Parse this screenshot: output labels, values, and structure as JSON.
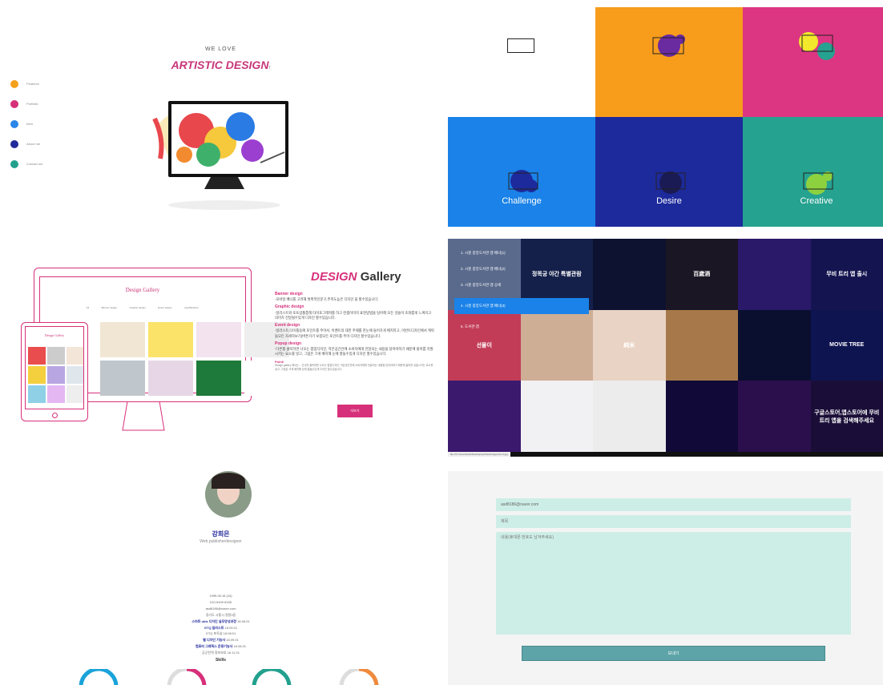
{
  "panel1": {
    "nav": [
      {
        "label": "Features",
        "color": "#f5a11c"
      },
      {
        "label": "Portfolio",
        "color": "#d7307a"
      },
      {
        "label": "Intro",
        "color": "#2a86e8"
      },
      {
        "label": "About me",
        "color": "#22299a"
      },
      {
        "label": "Contact me",
        "color": "#22a08e"
      }
    ],
    "we_love": "WE LOVE",
    "artistic": "ARTISTIC DESIGN",
    "artistic_suffix": "!"
  },
  "panel2": {
    "tiles": [
      {
        "label": "",
        "color": "#ffffff"
      },
      {
        "label": "",
        "color": "#f89c1c"
      },
      {
        "label": "",
        "color": "#dc3682"
      },
      {
        "label": "Challenge",
        "color": "#1a82e8"
      },
      {
        "label": "Desire",
        "color": "#1d2a9c"
      },
      {
        "label": "Creative",
        "color": "#26a290"
      }
    ]
  },
  "panel3": {
    "mock_title": "Design Gallery",
    "mock_tabs": [
      "All",
      "Banner design",
      "Graphic design",
      "Event design",
      "App/Web/etc."
    ],
    "tablet_title": "Design Gallery",
    "title_pink": "DESIGN",
    "title_dark": "Gallery",
    "sections": [
      {
        "h": "Banner design",
        "t": "-모바일 배너를 고려해 쌍촉적인문구,주목도높은 디자인 을 할수있습니다."
      },
      {
        "h": "Graphic design",
        "t": "-일러스트와 포토샵툴통해 타이포그래피를 하고 컨셉이미지 표현방법을 담아해 모든 것들이 조화롭게 느껴지고 의미가 전달될수있게 디자인 할수있습니다."
      },
      {
        "h": "Event design",
        "t": "-일러스트,타이틀등에 포인트를 주어서, 이벤트의 대한 주제를 한눈에 들어가게 배치하고, 이번트디자인에서 캐릭들모든 자세하보기(버튼가기 보봉모든 포인트를 주어 디자인 할수있습니다."
      },
      {
        "h": "Popup design",
        "t": "-다른를 클릭하면 나오는 팝업디자인, 작은공간안에 소비자에게 전달되는 내용을 담아야하기 때문에 홍미롭 유발시키는 요소를 넣고, 그림은 크게 배치해 눈에 잘들수있게 디자인 할수있습니다."
      },
      {
        "h": "Point!",
        "t": "Design gallery 에서는... 선사를 클릭하면 나오는 팝업디자인, 작은공간안에 소비자에게 전달되는 내용을 담아야하기 때문에 흥미를 유발시키는 요소를 넣고, 그림은 크게 배치해 눈에 잘들수있게 디자인 할수있습니다."
      }
    ],
    "button": "더보기"
  },
  "panel4": {
    "menu": [
      "1. 시흥 중앙도서관 앱 배너(1)",
      "2. 시흥 중앙도서관 앱 배너(2)",
      "3. 시흥 중앙도서관 앱 상세",
      "4. 시흥 중앙도서관 앱 배너(3)",
      "5. 도서관 앱"
    ],
    "active_index": 3,
    "thumbs": [
      {
        "text": "",
        "color": "#5a6a8c"
      },
      {
        "text": "정목궁 야간 특별관람",
        "color": "#14204a"
      },
      {
        "text": "",
        "color": "#0d1230"
      },
      {
        "text": "百歲酒",
        "color": "#1a1624"
      },
      {
        "text": "",
        "color": "#2a1868"
      },
      {
        "text": "무비 트리 앱 출시",
        "color": "#141450"
      },
      {
        "text": "선물이",
        "color": "#c23c58"
      },
      {
        "text": "",
        "color": "#cfae96"
      },
      {
        "text": "純米",
        "color": "#e9d3c4"
      },
      {
        "text": "",
        "color": "#a7794a"
      },
      {
        "text": "",
        "color": "#0a0f30"
      },
      {
        "text": "MOVIE TREE",
        "color": "#0e1450"
      },
      {
        "text": "",
        "color": "#3b1a6e"
      },
      {
        "text": "",
        "color": "#f1f1f3"
      },
      {
        "text": "",
        "color": "#ececec"
      },
      {
        "text": "",
        "color": "#110a38"
      },
      {
        "text": "",
        "color": "#2b0e4c"
      },
      {
        "text": "구글스토어,앱스토어에 무비트리 앱을 검색해주세요",
        "color": "#1a0e38"
      }
    ],
    "status_url": "file:///C:/Users/harin/Desktop/portfolio/images/s1-3.jpg"
  },
  "panel5": {
    "name": "강희은",
    "role": "Web publisher/designer",
    "info": [
      {
        "b": "",
        "t": "1995.08.18 (24)"
      },
      {
        "b": "",
        "t": "010-5490 8185"
      },
      {
        "b": "",
        "t": "asd8186@naver.com"
      },
      {
        "b": "",
        "t": "경기도 시흥시 정왕3동"
      },
      {
        "b": "스마트 ubiz 디자인 실무양성과정",
        "t": " 18.08.01"
      },
      {
        "b": "GTQ 일러스트",
        "t": " 18.09.01"
      },
      {
        "b": "",
        "t": "GTQ 포토샵 18.08.01"
      },
      {
        "b": "웹 디자인 기능사",
        "t": " 18.09.01"
      },
      {
        "b": "컴퓨터 그래픽스 운용기능사",
        "t": " 18.08.01"
      },
      {
        "b": "",
        "t": "공군전역 정보보호 16.11.01"
      }
    ],
    "skills_label": "Skills",
    "skill_colors": [
      "#1aa3d9",
      "#d7307a",
      "#22a08e",
      "#f08a3c"
    ]
  },
  "panel6": {
    "email": "asd8186@naver.com",
    "subject_ph": "제목",
    "message_ph": "내용(휴대폰 번호도 남겨주세요)",
    "send": "보내기"
  }
}
